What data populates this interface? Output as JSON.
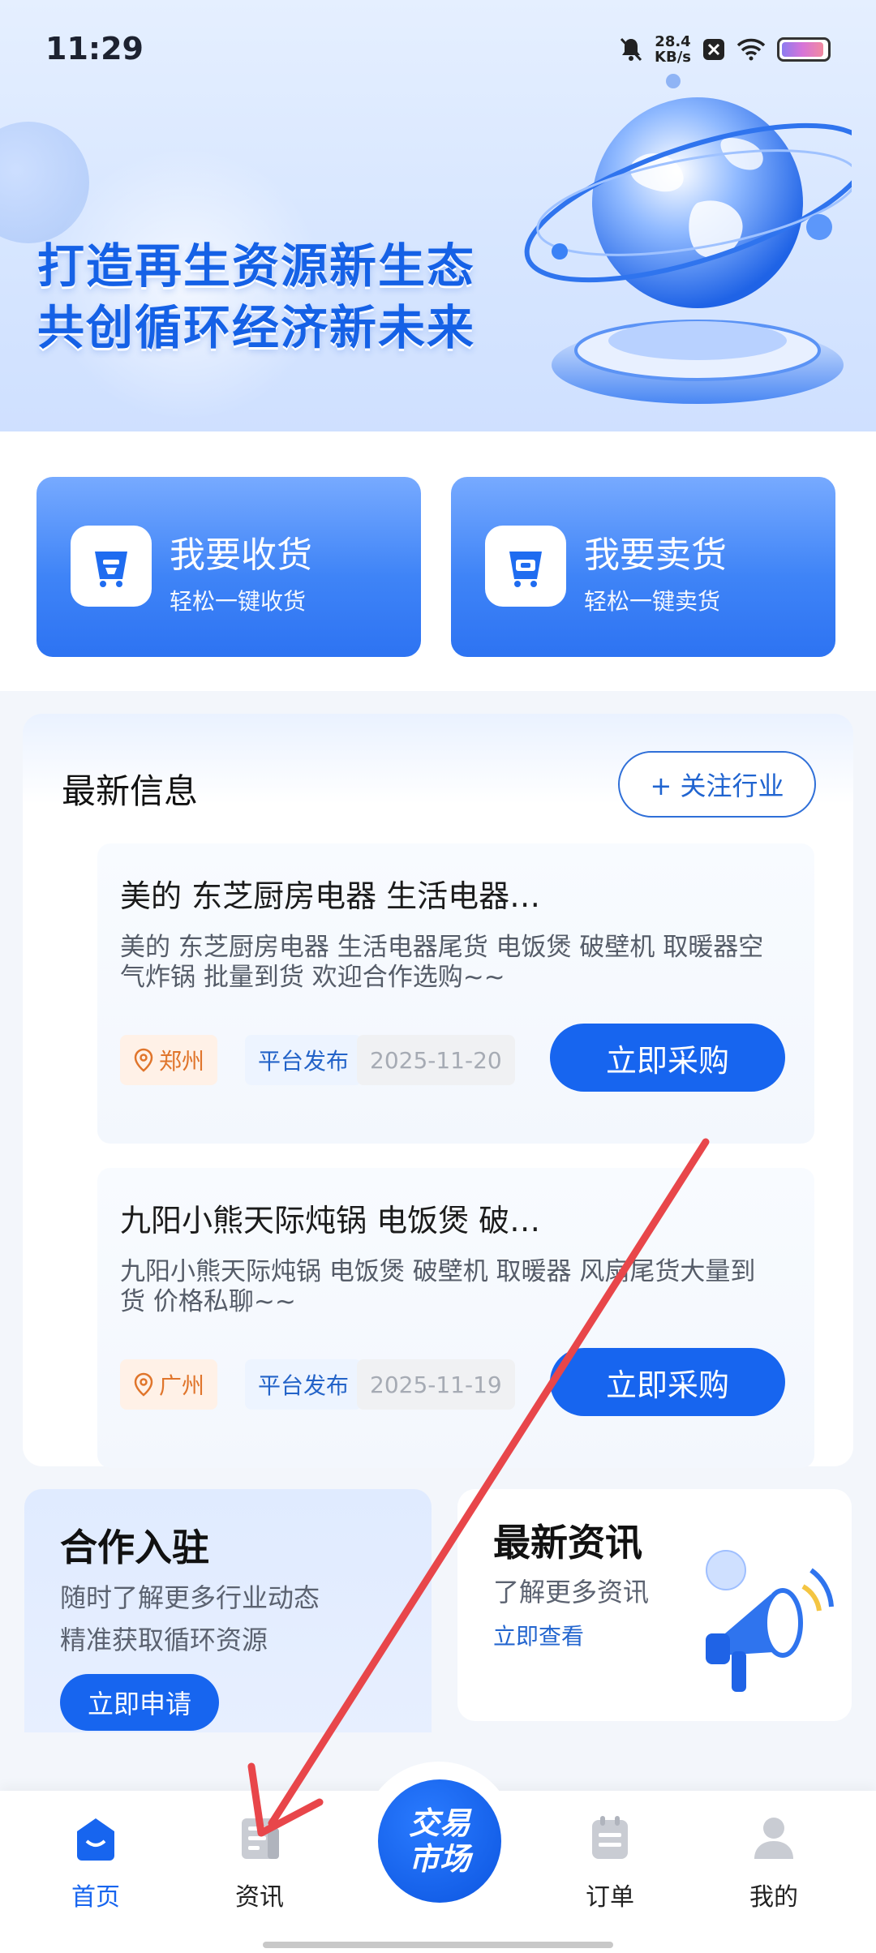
{
  "status_bar": {
    "time": "11:29",
    "speed_value": "28.4",
    "speed_unit": "KB/s"
  },
  "hero": {
    "line1": "打造再生资源新生态",
    "line2": "共创循环经济新未来"
  },
  "actions": [
    {
      "title": "我要收货",
      "subtitle": "轻松一键收货"
    },
    {
      "title": "我要卖货",
      "subtitle": "轻松一键卖货"
    }
  ],
  "latest_info": {
    "title": "最新信息",
    "follow_label": "+ 关注行业",
    "items": [
      {
        "title": "美的 东芝厨房电器 生活电器…",
        "desc": "美的 东芝厨房电器 生活电器尾货 电饭煲 破壁机 取暖器空气炸锅 批量到货 欢迎合作选购~~",
        "location": "郑州",
        "publisher": "平台发布",
        "date": "2025-11-20",
        "button": "立即采购"
      },
      {
        "title": "九阳小熊天际炖锅 电饭煲 破…",
        "desc": "九阳小熊天际炖锅 电饭煲 破壁机 取暖器 风扇尾货大量到货 价格私聊~~",
        "location": "广州",
        "publisher": "平台发布",
        "date": "2025-11-19",
        "button": "立即采购"
      }
    ]
  },
  "promo_left": {
    "title": "合作入驻",
    "line1": "随时了解更多行业动态",
    "line2": "精准获取循环资源",
    "button": "立即申请"
  },
  "promo_right": {
    "title": "最新资讯",
    "subtitle": "了解更多资讯",
    "link": "立即查看"
  },
  "tabbar": {
    "home": "首页",
    "news": "资讯",
    "center_line1": "交易",
    "center_line2": "市场",
    "orders": "订单",
    "mine": "我的"
  },
  "colors": {
    "primary": "#1765ef",
    "annotation_arrow": "#e8464a"
  }
}
